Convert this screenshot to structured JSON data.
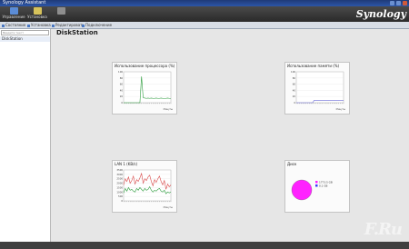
{
  "window": {
    "title": "Synology Assistant"
  },
  "toolbar": {
    "items": [
      {
        "label": "Управление"
      },
      {
        "label": "Установка"
      },
      {
        "label": ""
      }
    ]
  },
  "brand": {
    "text": "Synology"
  },
  "nav": {
    "items": [
      {
        "label": "Состояние"
      },
      {
        "label": "Установка"
      },
      {
        "label": "Редактировать"
      },
      {
        "label": "Подключение"
      }
    ]
  },
  "sidebar": {
    "search_placeholder": "Введите текст",
    "items": [
      {
        "label": "DiskStation"
      }
    ]
  },
  "page": {
    "title": "DiskStation"
  },
  "panels": {
    "cpu": {
      "title": "Использование процессора (%)",
      "xlabel": "Минуты"
    },
    "mem": {
      "title": "Использование памяти (%)",
      "xlabel": "Минуты"
    },
    "lan": {
      "title": "LAN 1 (KB/s)",
      "xlabel": "Минуты"
    },
    "disk": {
      "title": "Диск"
    }
  },
  "watermark": "F.Ru",
  "colors": {
    "cpu_line": "#2f9e3f",
    "mem_line": "#6a6ad8",
    "lan_tx": "#2f9e3f",
    "lan_rx": "#d94a4a",
    "disk_used": "#ff22ff",
    "disk_free": "#3a3aff"
  },
  "chart_data": [
    {
      "type": "line",
      "title": "Использование процессора (%)",
      "xlabel": "Минуты",
      "ylim": [
        0,
        100
      ],
      "yticks": [
        0,
        20,
        40,
        60,
        80,
        100
      ],
      "series": [
        {
          "values": [
            0,
            0,
            0,
            0,
            0,
            0,
            0,
            0,
            0,
            0,
            0,
            85,
            16,
            15,
            14,
            15,
            14,
            15,
            14,
            14,
            15,
            14,
            14,
            15,
            14,
            14,
            14,
            15,
            14,
            14
          ]
        }
      ]
    },
    {
      "type": "line",
      "title": "Использование памяти (%)",
      "xlabel": "Минуты",
      "ylim": [
        0,
        100
      ],
      "yticks": [
        0,
        20,
        40,
        60,
        80,
        100
      ],
      "series": [
        {
          "values": [
            0,
            0,
            0,
            0,
            0,
            0,
            0,
            0,
            0,
            0,
            0,
            8,
            8,
            8,
            8,
            8,
            8,
            8,
            8,
            8,
            8,
            8,
            8,
            8,
            8,
            8,
            8,
            8,
            8,
            8
          ]
        }
      ]
    },
    {
      "type": "line",
      "title": "LAN 1 (KB/s)",
      "xlabel": "Минуты",
      "ylim": [
        0,
        3500
      ],
      "yticks": [
        0,
        500,
        1000,
        1500,
        2000,
        2500,
        3000,
        3500
      ],
      "series": [
        {
          "values": [
            1800,
            2500,
            2200,
            2700,
            2000,
            2300,
            2800,
            1900,
            2400,
            2200,
            2600,
            3100,
            2000,
            2500,
            2300,
            2700,
            2900,
            2200,
            1700,
            2400,
            2100,
            2500,
            2800,
            2200,
            1800,
            2300,
            1300,
            1900,
            1600,
            1800
          ]
        },
        {
          "values": [
            900,
            1400,
            1100,
            1500,
            1200,
            1300,
            1100,
            1000,
            1400,
            1200,
            1500,
            1300,
            1100,
            1400,
            1200,
            1300,
            1600,
            1200,
            1000,
            1200,
            1100,
            1300,
            1400,
            1100,
            1000,
            1200,
            800,
            1000,
            900,
            1000
          ]
        }
      ]
    },
    {
      "type": "pie",
      "title": "Диск",
      "slices": [
        {
          "label": "1773.5 GB",
          "value": 1773.5
        },
        {
          "label": "0.1 GB",
          "value": 0.1
        }
      ]
    }
  ]
}
